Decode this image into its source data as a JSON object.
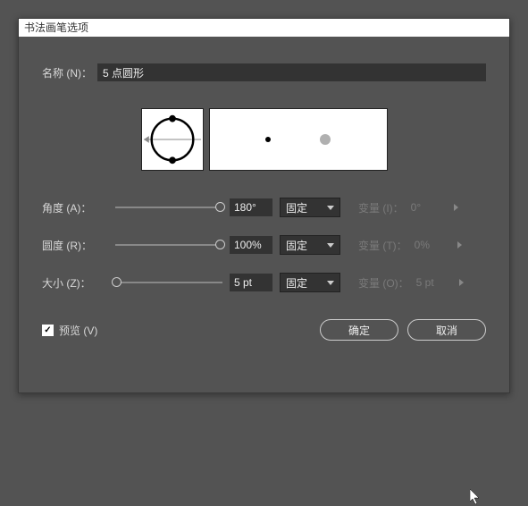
{
  "dialog": {
    "title": "书法画笔选项",
    "name_label": "名称 (N)：",
    "name_value": "5 点圆形"
  },
  "rows": {
    "angle": {
      "label": "角度 (A)：",
      "value": "180°",
      "mode": "固定",
      "var_label": "变量 (I)：",
      "var_value": "0°"
    },
    "roundness": {
      "label": "圆度 (R)：",
      "value": "100%",
      "mode": "固定",
      "var_label": "变量 (T)：",
      "var_value": "0%"
    },
    "size": {
      "label": "大小 (Z)：",
      "value": "5 pt",
      "mode": "固定",
      "var_label": "变量 (O)：",
      "var_value": "5 pt"
    }
  },
  "footer": {
    "preview_label": "预览 (V)",
    "ok": "确定",
    "cancel": "取消"
  }
}
